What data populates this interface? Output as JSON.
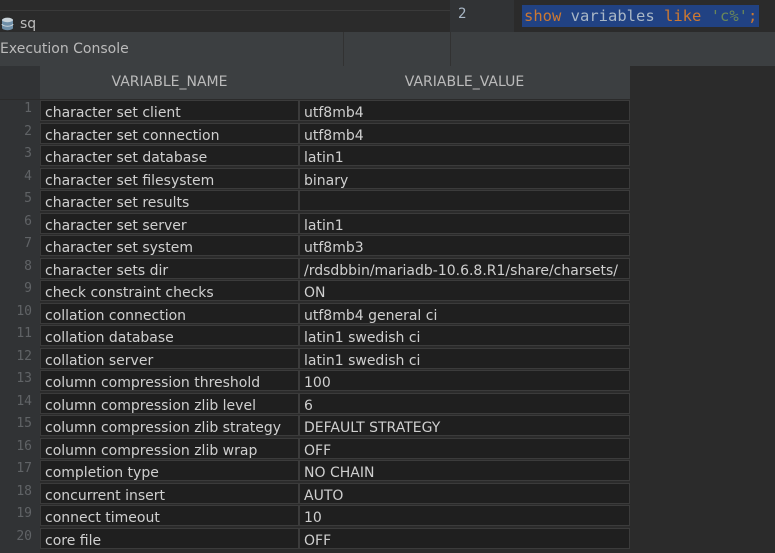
{
  "editor": {
    "tree_label": "sq",
    "line_number": "2",
    "code_tokens": {
      "show": "show",
      "variables": "variables",
      "like": "like",
      "pattern": "'c%'",
      "terminator": ";"
    }
  },
  "console": {
    "title": "Execution Console"
  },
  "grid": {
    "columns": [
      "VARIABLE_NAME",
      "VARIABLE_VALUE"
    ],
    "rows": [
      {
        "n": "1",
        "name": "character set client",
        "value": "utf8mb4"
      },
      {
        "n": "2",
        "name": "character set connection",
        "value": "utf8mb4"
      },
      {
        "n": "3",
        "name": "character set database",
        "value": "latin1"
      },
      {
        "n": "4",
        "name": "character set filesystem",
        "value": "binary"
      },
      {
        "n": "5",
        "name": "character set results",
        "value": ""
      },
      {
        "n": "6",
        "name": "character set server",
        "value": "latin1"
      },
      {
        "n": "7",
        "name": "character set system",
        "value": "utf8mb3"
      },
      {
        "n": "8",
        "name": "character sets dir",
        "value": "/rdsdbbin/mariadb-10.6.8.R1/share/charsets/"
      },
      {
        "n": "9",
        "name": "check constraint checks",
        "value": "ON"
      },
      {
        "n": "10",
        "name": "collation connection",
        "value": "utf8mb4 general ci"
      },
      {
        "n": "11",
        "name": "collation database",
        "value": "latin1 swedish ci"
      },
      {
        "n": "12",
        "name": "collation server",
        "value": "latin1 swedish ci"
      },
      {
        "n": "13",
        "name": "column compression threshold",
        "value": "100"
      },
      {
        "n": "14",
        "name": "column compression zlib level",
        "value": "6"
      },
      {
        "n": "15",
        "name": "column compression zlib strategy",
        "value": "DEFAULT STRATEGY"
      },
      {
        "n": "16",
        "name": "column compression zlib wrap",
        "value": "OFF"
      },
      {
        "n": "17",
        "name": "completion type",
        "value": "NO CHAIN"
      },
      {
        "n": "18",
        "name": "concurrent insert",
        "value": "AUTO"
      },
      {
        "n": "19",
        "name": "connect timeout",
        "value": "10"
      },
      {
        "n": "20",
        "name": "core file",
        "value": "OFF"
      }
    ]
  }
}
